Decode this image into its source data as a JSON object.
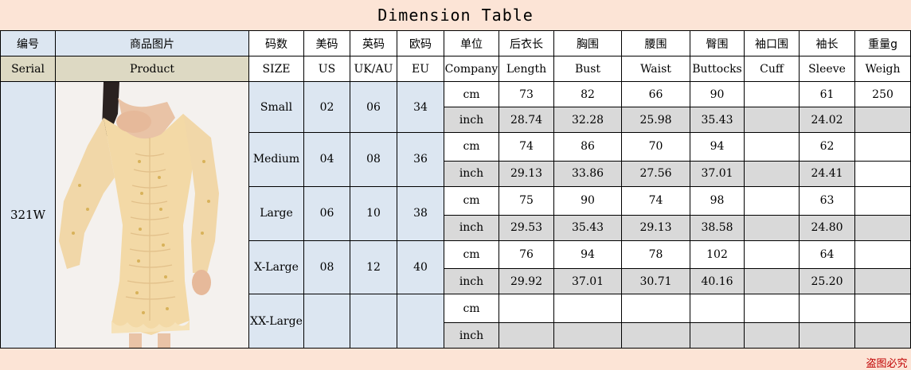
{
  "title": "Dimension Table",
  "headers_cn": [
    "编号",
    "商品图片",
    "码数",
    "美码",
    "英码",
    "欧码",
    "单位",
    "后衣长",
    "胸围",
    "腰围",
    "臀围",
    "袖口围",
    "袖长",
    "重量g"
  ],
  "headers_en": [
    "Serial",
    "Product",
    "SIZE",
    "US",
    "UK/AU",
    "EU",
    "Company",
    "Length",
    "Bust",
    "Waist",
    "Buttocks",
    "Cuff",
    "Sleeve",
    "Weigh"
  ],
  "serial": "321W",
  "sizes": [
    {
      "name": "Small",
      "us": "02",
      "uk": "06",
      "eu": "34",
      "cm": {
        "unit": "cm",
        "length": "73",
        "bust": "82",
        "waist": "66",
        "buttocks": "90",
        "cuff": "",
        "sleeve": "61",
        "weight": "250"
      },
      "inch": {
        "unit": "inch",
        "length": "28.74",
        "bust": "32.28",
        "waist": "25.98",
        "buttocks": "35.43",
        "cuff": "",
        "sleeve": "24.02",
        "weight": ""
      }
    },
    {
      "name": "Medium",
      "us": "04",
      "uk": "08",
      "eu": "36",
      "cm": {
        "unit": "cm",
        "length": "74",
        "bust": "86",
        "waist": "70",
        "buttocks": "94",
        "cuff": "",
        "sleeve": "62",
        "weight": ""
      },
      "inch": {
        "unit": "inch",
        "length": "29.13",
        "bust": "33.86",
        "waist": "27.56",
        "buttocks": "37.01",
        "cuff": "",
        "sleeve": "24.41",
        "weight": ""
      }
    },
    {
      "name": "Large",
      "us": "06",
      "uk": "10",
      "eu": "38",
      "cm": {
        "unit": "cm",
        "length": "75",
        "bust": "90",
        "waist": "74",
        "buttocks": "98",
        "cuff": "",
        "sleeve": "63",
        "weight": ""
      },
      "inch": {
        "unit": "inch",
        "length": "29.53",
        "bust": "35.43",
        "waist": "29.13",
        "buttocks": "38.58",
        "cuff": "",
        "sleeve": "24.80",
        "weight": ""
      }
    },
    {
      "name": "X-Large",
      "us": "08",
      "uk": "12",
      "eu": "40",
      "cm": {
        "unit": "cm",
        "length": "76",
        "bust": "94",
        "waist": "78",
        "buttocks": "102",
        "cuff": "",
        "sleeve": "64",
        "weight": ""
      },
      "inch": {
        "unit": "inch",
        "length": "29.92",
        "bust": "37.01",
        "waist": "30.71",
        "buttocks": "40.16",
        "cuff": "",
        "sleeve": "25.20",
        "weight": ""
      }
    },
    {
      "name": "XX-Large",
      "us": "",
      "uk": "",
      "eu": "",
      "cm": {
        "unit": "cm",
        "length": "",
        "bust": "",
        "waist": "",
        "buttocks": "",
        "cuff": "",
        "sleeve": "",
        "weight": ""
      },
      "inch": {
        "unit": "inch",
        "length": "",
        "bust": "",
        "waist": "",
        "buttocks": "",
        "cuff": "",
        "sleeve": "",
        "weight": ""
      }
    }
  ],
  "footer": "盗图必究",
  "colors": {
    "title_bg": "#fce4d6",
    "header_blue": "#dce6f1",
    "header_tan": "#ddd9c3",
    "inch_row_gray": "#d9d9d9",
    "footer_red": "#c00000"
  }
}
